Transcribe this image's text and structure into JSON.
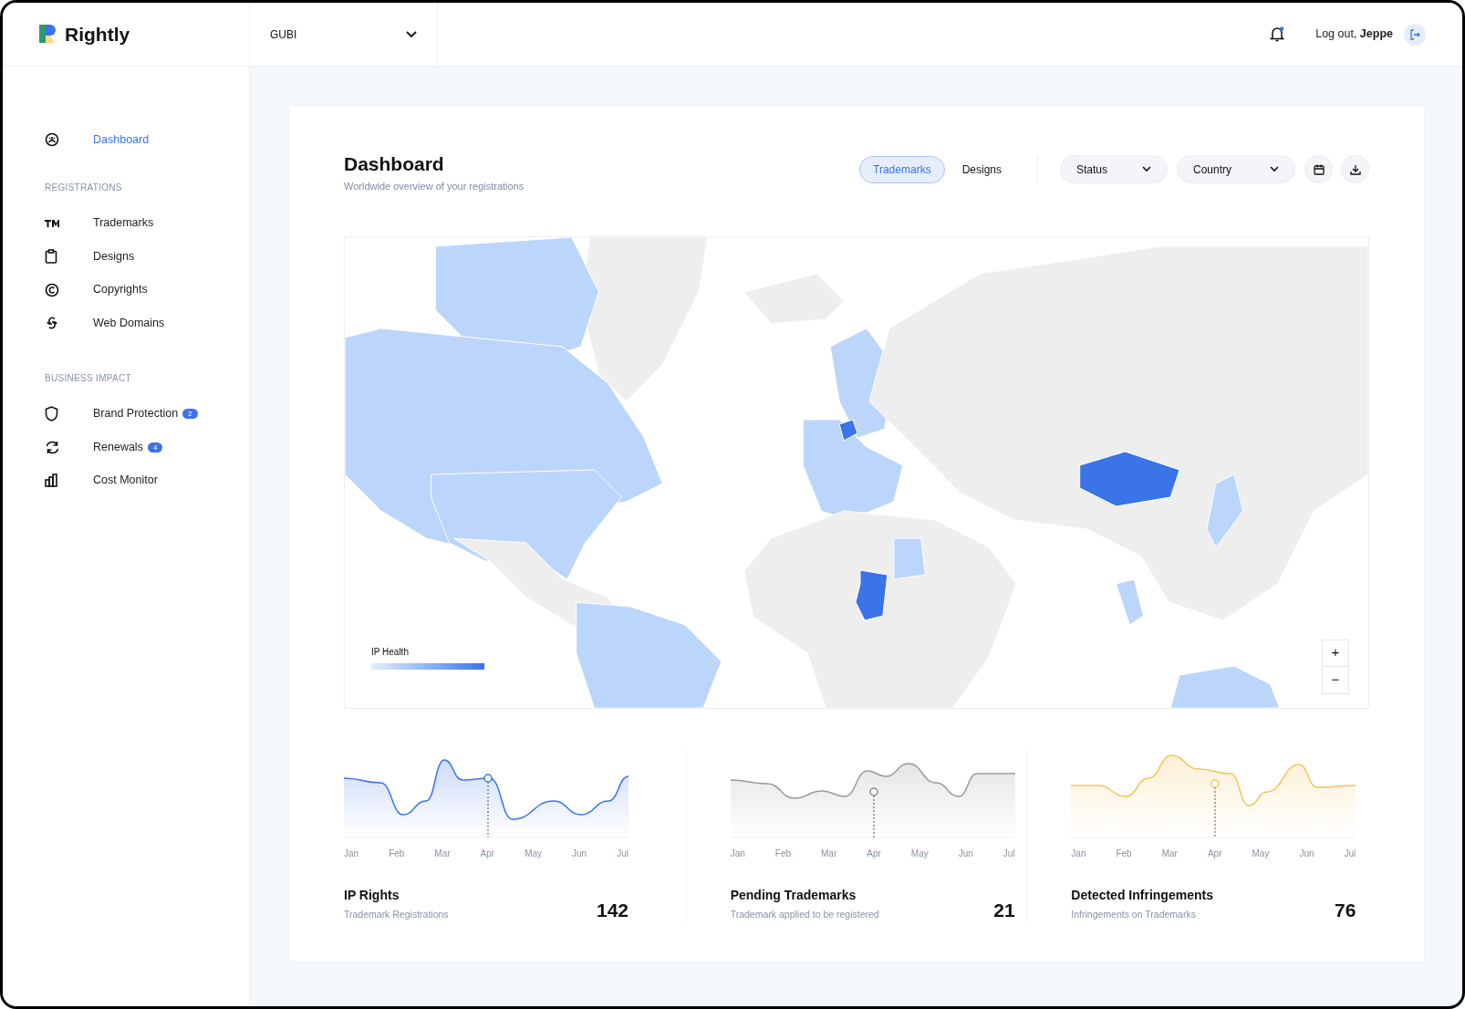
{
  "brand": {
    "name": "Rightly"
  },
  "company_select": {
    "value": "GUBI"
  },
  "header": {
    "has_notification": true,
    "logout_text": "Log out, ",
    "user": "Jeppe"
  },
  "sidebar": {
    "sections": [
      {
        "items": [
          {
            "label": "Dashboard",
            "selected": true
          }
        ]
      },
      {
        "heading": "REGISTRATIONS",
        "items": [
          {
            "label": "Trademarks",
            "selected": false
          },
          {
            "label": "Designs",
            "selected": false
          },
          {
            "label": "Copyrights",
            "selected": false
          },
          {
            "label": "Web Domains",
            "selected": false
          }
        ]
      },
      {
        "heading": "BUSINESS IMPACT",
        "items": [
          {
            "label": "Brand Protection",
            "selected": false,
            "badge": "2"
          },
          {
            "label": "Renewals",
            "selected": false,
            "badge": "4"
          },
          {
            "label": "Cost Monitor",
            "selected": false
          }
        ]
      }
    ]
  },
  "page": {
    "title": "Dashboard",
    "subtitle": "Worldwide overview of your registrations"
  },
  "tabs": [
    {
      "label": "Trademarks",
      "selected": true
    },
    {
      "label": "Designs",
      "selected": false
    }
  ],
  "filters": [
    {
      "label": "Status"
    },
    {
      "label": "Country"
    }
  ],
  "map": {
    "legend_title": "IP Health",
    "zoom_in": "+",
    "zoom_out": "−"
  },
  "stats": [
    {
      "title": "IP Rights",
      "subtitle": "Trademark Registrations",
      "value": "142",
      "color": "#3b73e8",
      "months": [
        "Jan",
        "Feb",
        "Mar",
        "Apr",
        "May",
        "Jun",
        "Jul"
      ]
    },
    {
      "title": "Pending Trademarks",
      "subtitle": "Trademark applied to be registered",
      "value": "21",
      "color": "#9a9a9a",
      "months": [
        "Jan",
        "Feb",
        "Mar",
        "Apr",
        "May",
        "Jun",
        "Jul"
      ]
    },
    {
      "title": "Detected Infringements",
      "subtitle": "Infringements on Trademarks",
      "value": "76",
      "color": "#f5c55a",
      "months": [
        "Jan",
        "Feb",
        "Mar",
        "Apr",
        "May",
        "Jun",
        "Jul"
      ]
    }
  ]
}
